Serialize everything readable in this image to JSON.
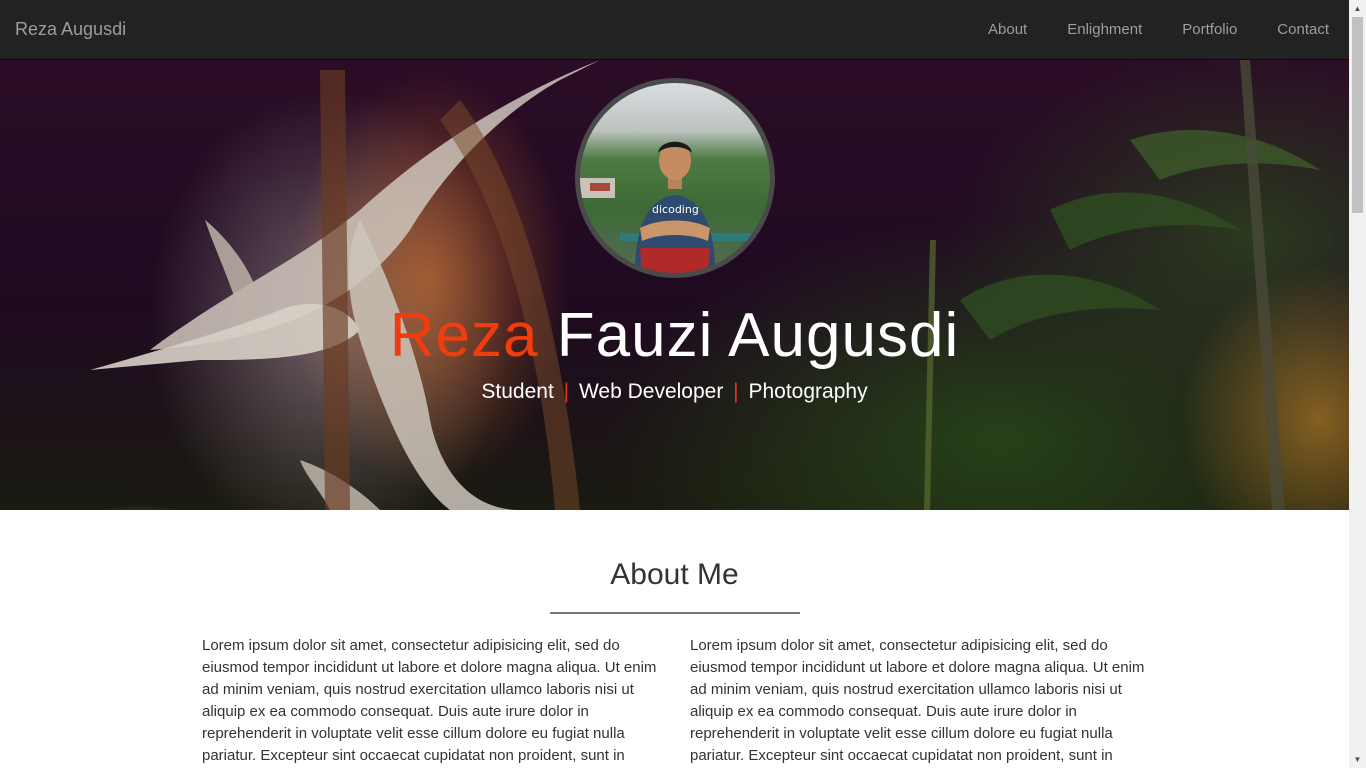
{
  "navbar": {
    "brand": "Reza Augusdi",
    "items": [
      {
        "label": "About"
      },
      {
        "label": "Enlighment"
      },
      {
        "label": "Portfolio"
      },
      {
        "label": "Contact"
      }
    ]
  },
  "hero": {
    "name_first": "Reza",
    "name_rest": "Fauzi Augusdi",
    "roles": [
      "Student",
      "Web Developer",
      "Photography"
    ],
    "separator": "|"
  },
  "about": {
    "title": "About Me",
    "left_text": "Lorem ipsum dolor sit amet, consectetur adipisicing elit, sed do eiusmod tempor incididunt ut labore et dolore magna aliqua. Ut enim ad minim veniam, quis nostrud exercitation ullamco laboris nisi ut aliquip ex ea commodo consequat. Duis aute irure dolor in reprehenderit in voluptate velit esse cillum dolore eu fugiat nulla pariatur. Excepteur sint occaecat cupidatat non proident, sunt in",
    "right_text": "Lorem ipsum dolor sit amet, consectetur adipisicing elit, sed do eiusmod tempor incididunt ut labore et dolore magna aliqua. Ut enim ad minim veniam, quis nostrud exercitation ullamco laboris nisi ut aliquip ex ea commodo consequat. Duis aute irure dolor in reprehenderit in voluptate velit esse cillum dolore eu fugiat nulla pariatur. Excepteur sint occaecat cupidatat non proident, sunt in"
  },
  "colors": {
    "navbar_bg": "#222222",
    "nav_text": "#9d9d9d",
    "accent": "#f03c0f"
  },
  "icons": {
    "scroll_up": "scroll-up-arrow-icon",
    "scroll_down": "scroll-down-arrow-icon"
  }
}
